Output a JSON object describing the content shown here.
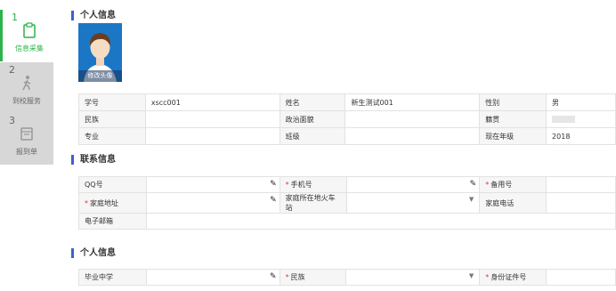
{
  "steps": [
    {
      "num": "1",
      "label": "信息采集",
      "icon": "clipboard-icon"
    },
    {
      "num": "2",
      "label": "到校服务",
      "icon": "walking-person-icon"
    },
    {
      "num": "3",
      "label": "报到单",
      "icon": "calendar-icon"
    }
  ],
  "personal": {
    "title": "个人信息",
    "avatar_label": "修改头像",
    "rows": [
      [
        "学号",
        "xscc001",
        "姓名",
        "新生测试001",
        "性别",
        "男"
      ],
      [
        "民族",
        "",
        "政治面貌",
        "",
        "籍贯",
        ""
      ],
      [
        "专业",
        "",
        "班级",
        "",
        "现在年级",
        "2018"
      ]
    ]
  },
  "contact": {
    "title": "联系信息",
    "qq": "QQ号",
    "phone": "手机号",
    "backup_phone": "备用号",
    "home_address": "家庭地址",
    "station": "家庭所在地火车站",
    "home_phone": "家庭电话",
    "email": "电子邮箱"
  },
  "personal2": {
    "title": "个人信息",
    "school": "毕业中学",
    "ethnicity": "民族",
    "id_no": "身份证件号"
  },
  "colors": {
    "accent": "#2db34a",
    "section_bar": "#3a63c9"
  }
}
